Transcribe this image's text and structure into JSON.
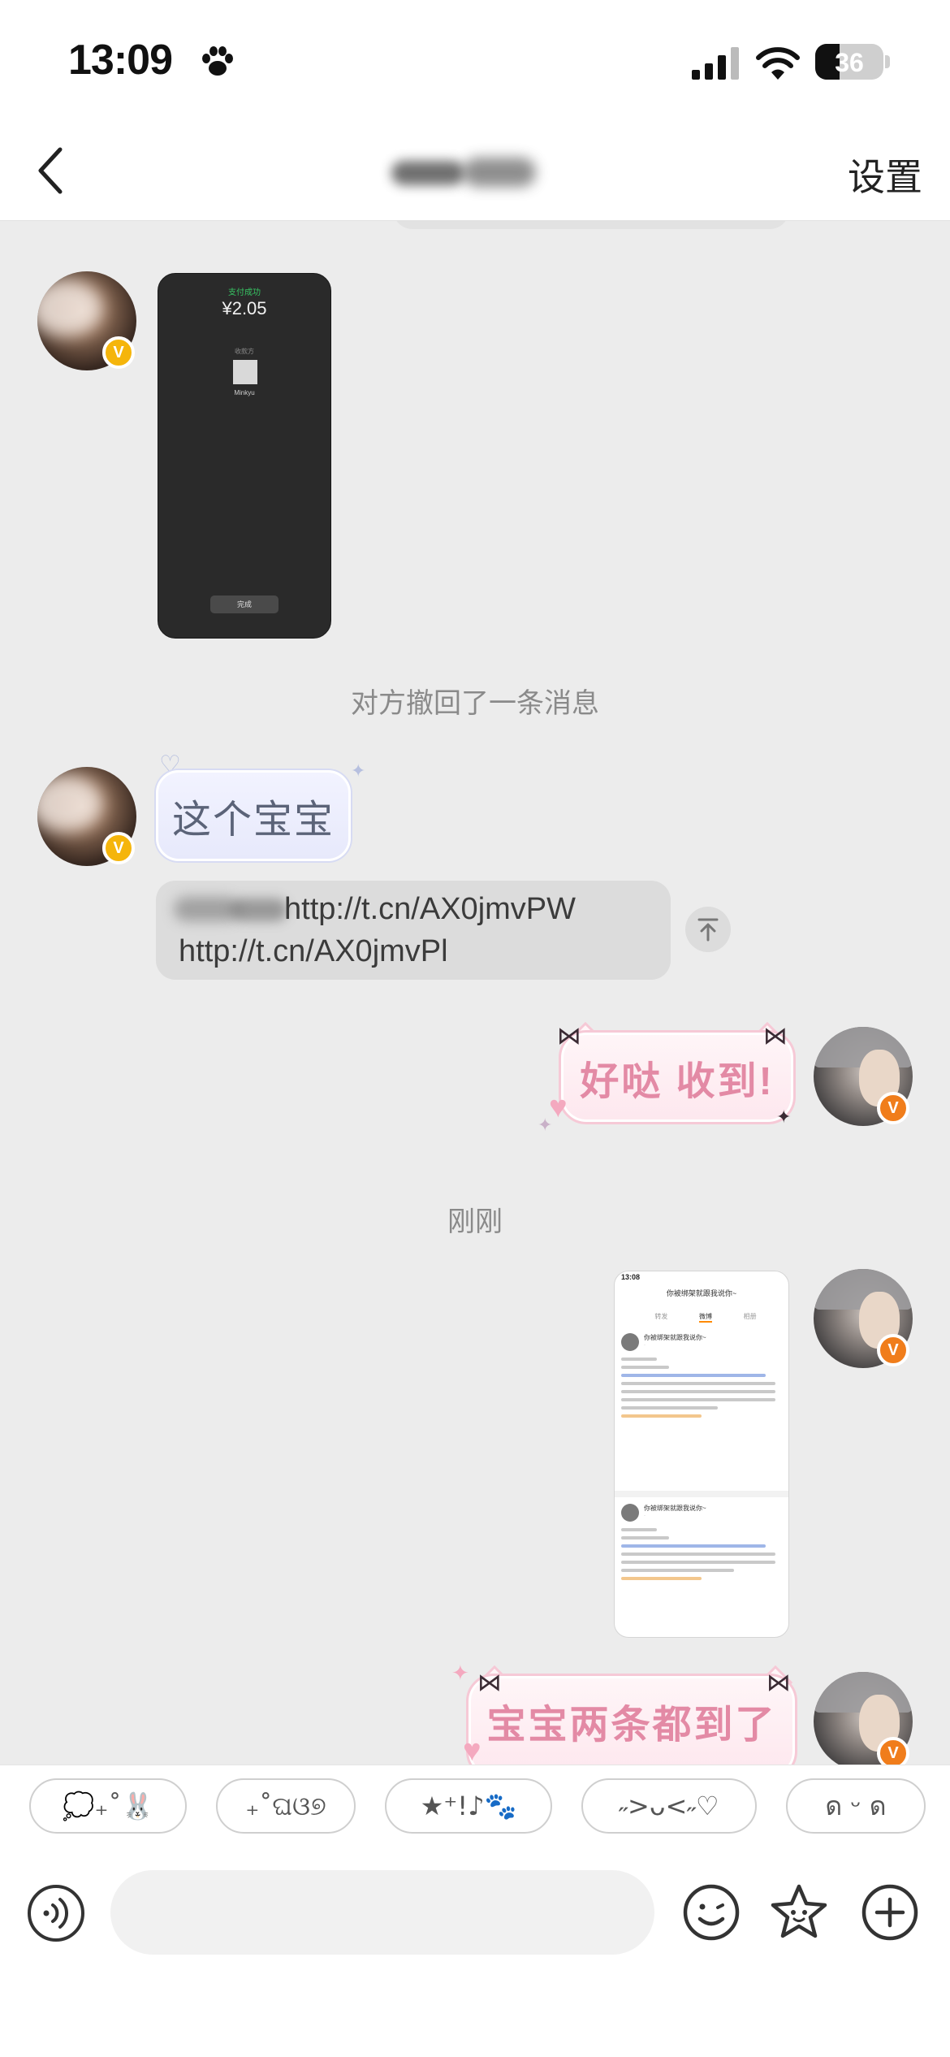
{
  "status_bar": {
    "time": "13:09",
    "battery_level": 36,
    "battery_text": "36",
    "icons": [
      "paw-icon",
      "signal-icon",
      "wifi-icon",
      "battery-icon"
    ]
  },
  "nav": {
    "back_icon": "chevron-left-icon",
    "settings_label": "设置"
  },
  "messages": {
    "payment_screenshot": {
      "app_label": "支付成功",
      "amount": "¥2.05",
      "payee_title": "收款方",
      "payee_name": "Minkyu",
      "done_label": "完成"
    },
    "recall_notice": "对方撤回了一条消息",
    "left_text": "这个宝宝",
    "link_line1": "http://t.cn/AX0jmvPW",
    "link_line2": "http://t.cn/AX0jmvPl",
    "reply_1": "好哒 收到!",
    "timestamp": "刚刚",
    "weibo_screenshot": {
      "status_time": "13:08",
      "title": "你被绑架就跟我说你~",
      "tabs": [
        "转发",
        "微博",
        "相册"
      ],
      "active_tab": "微博"
    },
    "reply_2": "宝宝两条都到了"
  },
  "emoticons": [
    "💭₊˚🐰",
    "₊˚ଘଓ୭",
    "★⁺!♪🐾",
    "˶>ᴗ<˶♡",
    "ด ᵕ ด"
  ],
  "input": {
    "placeholder": ""
  },
  "colors": {
    "chat_background": "#ececec",
    "pink_bubble_text": "#e38aa5",
    "verified_gold": "#f5b50b",
    "verified_orange": "#f07d1b"
  }
}
